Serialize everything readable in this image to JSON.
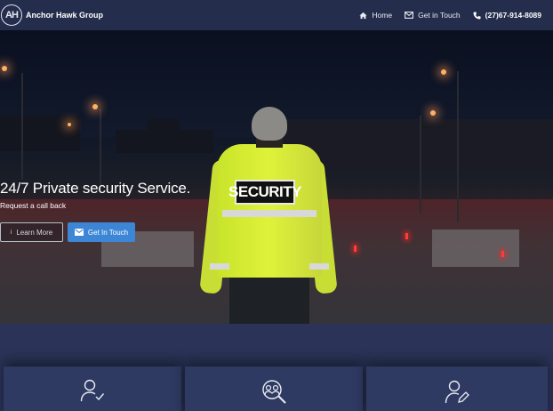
{
  "navbar": {
    "logo_text": "AH",
    "brand_name": "Anchor Hawk Group",
    "links": [
      {
        "label": "Home",
        "icon": "home-icon"
      },
      {
        "label": "Get in Touch",
        "icon": "envelope-icon"
      },
      {
        "label": "(27)67-914-8089",
        "icon": "phone-icon"
      }
    ]
  },
  "hero": {
    "title": "24/7 Private security Service.",
    "subtitle": "Request a call back",
    "image_patch_text": "SECURITY",
    "buttons": {
      "learn_more": {
        "label": "Learn More",
        "icon": "info-icon"
      },
      "get_in_touch": {
        "label": "Get In Touch",
        "icon": "envelope-icon"
      }
    }
  },
  "services": {
    "cards": [
      {
        "icon": "user-check-icon"
      },
      {
        "icon": "people-search-icon"
      },
      {
        "icon": "user-edit-icon"
      }
    ]
  },
  "colors": {
    "navbar_bg": "#242d4c",
    "primary_button": "#3d86d6",
    "services_bg": "#2b3458",
    "card_bg": "#2f3a62"
  }
}
